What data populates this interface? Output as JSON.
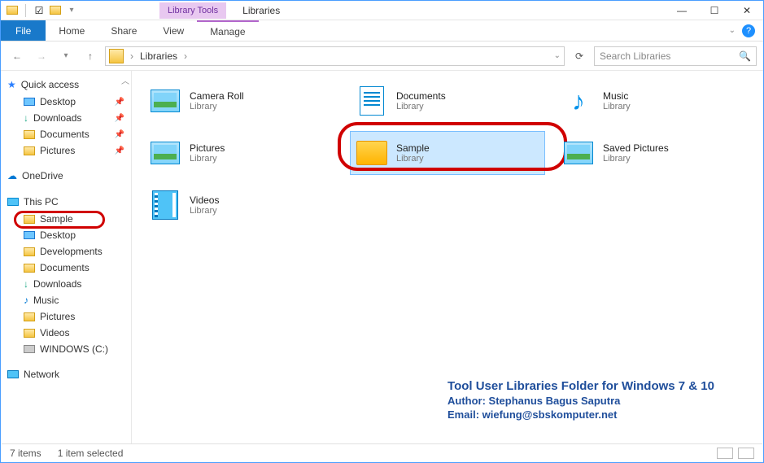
{
  "window": {
    "title": "Libraries",
    "contextual_tab": "Library Tools"
  },
  "ribbon": {
    "file": "File",
    "home": "Home",
    "share": "Share",
    "view": "View",
    "manage": "Manage"
  },
  "address": {
    "location": "Libraries",
    "sep": "›"
  },
  "search": {
    "placeholder": "Search Libraries"
  },
  "sidebar": {
    "quick_access": "Quick access",
    "qa": {
      "desktop": "Desktop",
      "downloads": "Downloads",
      "documents": "Documents",
      "pictures": "Pictures"
    },
    "onedrive": "OneDrive",
    "this_pc": "This PC",
    "pc": {
      "sample": "Sample",
      "desktop": "Desktop",
      "developments": "Developments",
      "documents": "Documents",
      "downloads": "Downloads",
      "music": "Music",
      "pictures": "Pictures",
      "videos": "Videos",
      "drive": "WINDOWS (C:)"
    },
    "network": "Network"
  },
  "items": {
    "sub": "Library",
    "camera_roll": "Camera Roll",
    "documents": "Documents",
    "music": "Music",
    "pictures": "Pictures",
    "sample": "Sample",
    "saved_pictures": "Saved Pictures",
    "videos": "Videos"
  },
  "overlay": {
    "title": "Tool User Libraries Folder for Windows 7 & 10",
    "author": "Author: Stephanus Bagus Saputra",
    "email": "Email: wiefung@sbskomputer.net"
  },
  "status": {
    "count": "7 items",
    "selected": "1 item selected"
  }
}
